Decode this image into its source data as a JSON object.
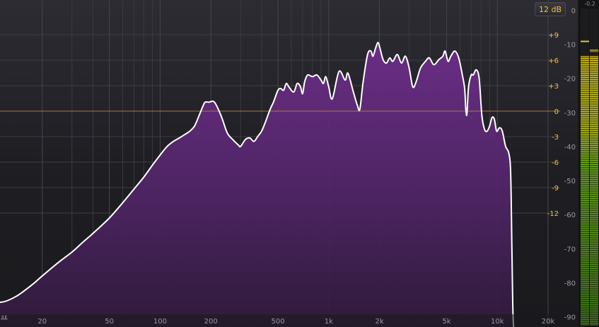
{
  "controls": {
    "range_label": "12 dB",
    "meter_peak_label": "-0.2"
  },
  "colors": {
    "background": "#1c1b20",
    "fill": "#5c2a72",
    "curve": "#ffffff",
    "gain_label": "#f3c23a",
    "db_label": "#9a99a0",
    "zero_line": "#b8893a",
    "meter_green": "#6fb21a",
    "meter_yellow": "#d8c21a"
  },
  "axes": {
    "freq_ticks": [
      {
        "f": 20,
        "label": "20"
      },
      {
        "f": 50,
        "label": "50"
      },
      {
        "f": 100,
        "label": "100"
      },
      {
        "f": 200,
        "label": "200"
      },
      {
        "f": 500,
        "label": "500"
      },
      {
        "f": 1000,
        "label": "1k"
      },
      {
        "f": 2000,
        "label": "2k"
      },
      {
        "f": 5000,
        "label": "5k"
      },
      {
        "f": 10000,
        "label": "10k"
      },
      {
        "f": 20000,
        "label": "20k"
      }
    ],
    "gain_ticks": [
      {
        "v": 9,
        "label": "+9"
      },
      {
        "v": 6,
        "label": "+6"
      },
      {
        "v": 3,
        "label": "+3"
      },
      {
        "v": 0,
        "label": "0"
      },
      {
        "v": -3,
        "label": "-3"
      },
      {
        "v": -6,
        "label": "-6"
      },
      {
        "v": -9,
        "label": "-9"
      },
      {
        "v": -12,
        "label": "-12"
      }
    ],
    "db_ticks": [
      {
        "v": 0,
        "label": "0"
      },
      {
        "v": -10,
        "label": "-10"
      },
      {
        "v": -20,
        "label": "-20"
      },
      {
        "v": -30,
        "label": "-30"
      },
      {
        "v": -40,
        "label": "-40"
      },
      {
        "v": -50,
        "label": "-50"
      },
      {
        "v": -60,
        "label": "-60"
      },
      {
        "v": -70,
        "label": "-70"
      },
      {
        "v": -80,
        "label": "-80"
      },
      {
        "v": -90,
        "label": "-90"
      }
    ]
  },
  "spectrum": {
    "freq_range": [
      10,
      30000
    ],
    "db_range": [
      -93,
      3
    ],
    "points": [
      [
        10,
        -86
      ],
      [
        12,
        -85.5
      ],
      [
        14,
        -84
      ],
      [
        16,
        -82
      ],
      [
        18,
        -80
      ],
      [
        20,
        -78
      ],
      [
        25,
        -74
      ],
      [
        30,
        -71
      ],
      [
        35,
        -68
      ],
      [
        40,
        -65.5
      ],
      [
        50,
        -61
      ],
      [
        60,
        -56.5
      ],
      [
        70,
        -52.5
      ],
      [
        80,
        -49
      ],
      [
        90,
        -45.5
      ],
      [
        100,
        -42.5
      ],
      [
        110,
        -40
      ],
      [
        120,
        -38.5
      ],
      [
        130,
        -37.5
      ],
      [
        140,
        -36.5
      ],
      [
        150,
        -35.5
      ],
      [
        160,
        -34
      ],
      [
        170,
        -31
      ],
      [
        180,
        -28
      ],
      [
        185,
        -27
      ],
      [
        195,
        -27
      ],
      [
        210,
        -27
      ],
      [
        230,
        -31
      ],
      [
        250,
        -36
      ],
      [
        270,
        -38
      ],
      [
        290,
        -39.5
      ],
      [
        300,
        -40
      ],
      [
        320,
        -38
      ],
      [
        340,
        -37.5
      ],
      [
        360,
        -38.5
      ],
      [
        380,
        -37
      ],
      [
        400,
        -35.5
      ],
      [
        420,
        -33
      ],
      [
        450,
        -29
      ],
      [
        470,
        -27
      ],
      [
        500,
        -23.5
      ],
      [
        520,
        -23
      ],
      [
        540,
        -23.5
      ],
      [
        560,
        -21.5
      ],
      [
        580,
        -22.5
      ],
      [
        620,
        -24
      ],
      [
        650,
        -21.5
      ],
      [
        680,
        -22.5
      ],
      [
        700,
        -24.5
      ],
      [
        720,
        -21
      ],
      [
        750,
        -19
      ],
      [
        800,
        -19.5
      ],
      [
        850,
        -19
      ],
      [
        900,
        -20.5
      ],
      [
        930,
        -21.5
      ],
      [
        960,
        -19.5
      ],
      [
        1000,
        -22.5
      ],
      [
        1050,
        -26
      ],
      [
        1150,
        -18
      ],
      [
        1250,
        -20.5
      ],
      [
        1300,
        -18.5
      ],
      [
        1400,
        -24
      ],
      [
        1480,
        -28
      ],
      [
        1530,
        -29
      ],
      [
        1600,
        -21
      ],
      [
        1700,
        -13
      ],
      [
        1780,
        -12
      ],
      [
        1830,
        -13.5
      ],
      [
        1900,
        -11
      ],
      [
        1960,
        -9.5
      ],
      [
        2010,
        -11
      ],
      [
        2100,
        -14.5
      ],
      [
        2200,
        -15.5
      ],
      [
        2300,
        -14
      ],
      [
        2400,
        -15
      ],
      [
        2550,
        -13
      ],
      [
        2700,
        -15.5
      ],
      [
        2850,
        -13.5
      ],
      [
        3000,
        -17
      ],
      [
        3150,
        -22.5
      ],
      [
        3300,
        -21
      ],
      [
        3500,
        -17
      ],
      [
        3750,
        -15
      ],
      [
        3950,
        -14
      ],
      [
        4200,
        -16
      ],
      [
        4500,
        -14.5
      ],
      [
        4750,
        -13.5
      ],
      [
        4900,
        -12
      ],
      [
        5100,
        -15
      ],
      [
        5300,
        -13.5
      ],
      [
        5600,
        -12
      ],
      [
        5900,
        -14
      ],
      [
        6200,
        -19
      ],
      [
        6400,
        -23
      ],
      [
        6500,
        -29
      ],
      [
        6600,
        -30.5
      ],
      [
        6750,
        -22.5
      ],
      [
        7000,
        -19
      ],
      [
        7200,
        -19
      ],
      [
        7500,
        -17.5
      ],
      [
        7800,
        -20
      ],
      [
        8100,
        -31
      ],
      [
        8400,
        -35
      ],
      [
        8700,
        -35.5
      ],
      [
        9000,
        -34
      ],
      [
        9300,
        -31.5
      ],
      [
        9600,
        -32
      ],
      [
        9900,
        -35.5
      ],
      [
        10300,
        -34.5
      ],
      [
        10700,
        -35.5
      ],
      [
        11200,
        -40
      ],
      [
        11700,
        -42
      ],
      [
        12000,
        -48
      ],
      [
        12200,
        -70
      ],
      [
        12400,
        -90
      ],
      [
        12700,
        -94
      ],
      [
        13500,
        -98
      ]
    ],
    "meter": {
      "channels": [
        {
          "level": 0.85,
          "peak": 0.9
        },
        {
          "level": 0.85,
          "peak": 0.87
        }
      ]
    }
  }
}
